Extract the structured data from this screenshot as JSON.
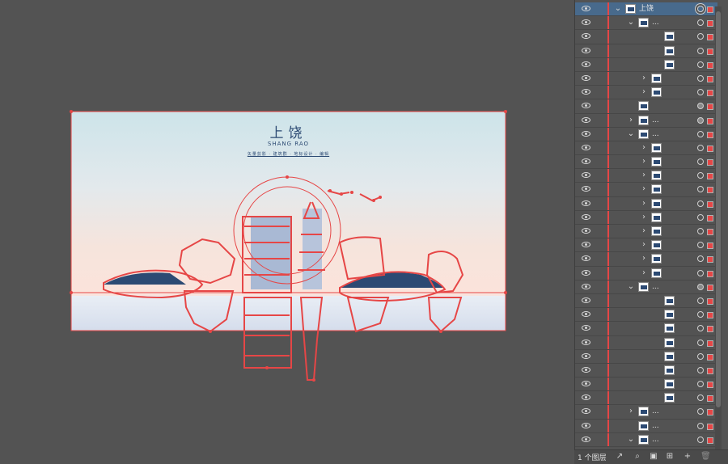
{
  "artboard": {
    "title_cn": "上饶",
    "title_en": "SHANG RAO",
    "subtitle": "矢量剪影 · 建筑群 · 地标设计 · 编辑"
  },
  "layers_panel": {
    "rows": [
      {
        "indent": 0,
        "expanded": true,
        "label": "上饶",
        "thumb": true,
        "selected": true,
        "target": "double"
      },
      {
        "indent": 1,
        "expanded": true,
        "label": "...",
        "thumb": true
      },
      {
        "indent": 3,
        "expanded": null,
        "label": "",
        "thumb": true
      },
      {
        "indent": 3,
        "expanded": null,
        "label": "",
        "thumb": true
      },
      {
        "indent": 3,
        "expanded": null,
        "label": "",
        "thumb": true
      },
      {
        "indent": 2,
        "expanded": false,
        "label": "",
        "thumb": true
      },
      {
        "indent": 2,
        "expanded": false,
        "label": "",
        "thumb": true
      },
      {
        "indent": 1,
        "expanded": null,
        "label": "",
        "thumb": true,
        "target": "filled"
      },
      {
        "indent": 1,
        "expanded": false,
        "label": "...",
        "thumb": true,
        "target": "filled"
      },
      {
        "indent": 1,
        "expanded": true,
        "label": "...",
        "thumb": true
      },
      {
        "indent": 2,
        "expanded": false,
        "label": "",
        "thumb": true
      },
      {
        "indent": 2,
        "expanded": false,
        "label": "",
        "thumb": true
      },
      {
        "indent": 2,
        "expanded": false,
        "label": "",
        "thumb": true
      },
      {
        "indent": 2,
        "expanded": false,
        "label": "",
        "thumb": true
      },
      {
        "indent": 2,
        "expanded": false,
        "label": "",
        "thumb": true
      },
      {
        "indent": 2,
        "expanded": false,
        "label": "",
        "thumb": true
      },
      {
        "indent": 2,
        "expanded": false,
        "label": "",
        "thumb": true
      },
      {
        "indent": 2,
        "expanded": false,
        "label": "",
        "thumb": true
      },
      {
        "indent": 2,
        "expanded": false,
        "label": "",
        "thumb": true
      },
      {
        "indent": 2,
        "expanded": false,
        "label": "",
        "thumb": true
      },
      {
        "indent": 1,
        "expanded": true,
        "label": "...",
        "thumb": true,
        "target": "filled"
      },
      {
        "indent": 3,
        "expanded": null,
        "label": "",
        "thumb": true
      },
      {
        "indent": 3,
        "expanded": null,
        "label": "",
        "thumb": true
      },
      {
        "indent": 3,
        "expanded": null,
        "label": "",
        "thumb": true
      },
      {
        "indent": 3,
        "expanded": null,
        "label": "",
        "thumb": true
      },
      {
        "indent": 3,
        "expanded": null,
        "label": "",
        "thumb": true
      },
      {
        "indent": 3,
        "expanded": null,
        "label": "",
        "thumb": true
      },
      {
        "indent": 3,
        "expanded": null,
        "label": "",
        "thumb": true
      },
      {
        "indent": 3,
        "expanded": null,
        "label": "",
        "thumb": true
      },
      {
        "indent": 1,
        "expanded": false,
        "label": "...",
        "thumb": true
      },
      {
        "indent": 1,
        "expanded": null,
        "label": "...",
        "thumb": true
      },
      {
        "indent": 1,
        "expanded": true,
        "label": "...",
        "thumb": true
      }
    ],
    "footer": {
      "layer_count": "1 个图层",
      "buttons": [
        "export-icon",
        "search-icon",
        "clip-icon",
        "sublayer-icon",
        "new-layer-icon",
        "trash-icon"
      ]
    }
  },
  "colors": {
    "accent_red": "#e64646",
    "panel_bg": "#535353",
    "selection_bg": "#486a8c",
    "navy": "#2c4a73"
  }
}
